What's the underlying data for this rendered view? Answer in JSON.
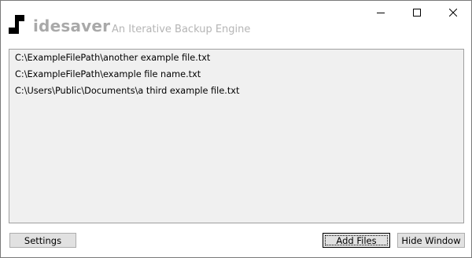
{
  "window": {
    "brand_name": "idesaver",
    "subtitle": "An Iterative Backup Engine",
    "controls": {
      "minimize_icon": "minimize-icon",
      "maximize_icon": "maximize-icon",
      "close_icon": "close-icon"
    }
  },
  "file_list": {
    "items": [
      "C:\\ExampleFilePath\\another example file.txt",
      "C:\\ExampleFilePath\\example file name.txt",
      "C:\\Users\\Public\\Documents\\a third example file.txt"
    ]
  },
  "buttons": {
    "settings": "Settings",
    "add_files": "Add Files",
    "hide_window": "Hide Window"
  },
  "colors": {
    "brand_text": "#a9a9a9",
    "list_background": "#f0f0f0",
    "button_background": "#e1e1e1"
  }
}
